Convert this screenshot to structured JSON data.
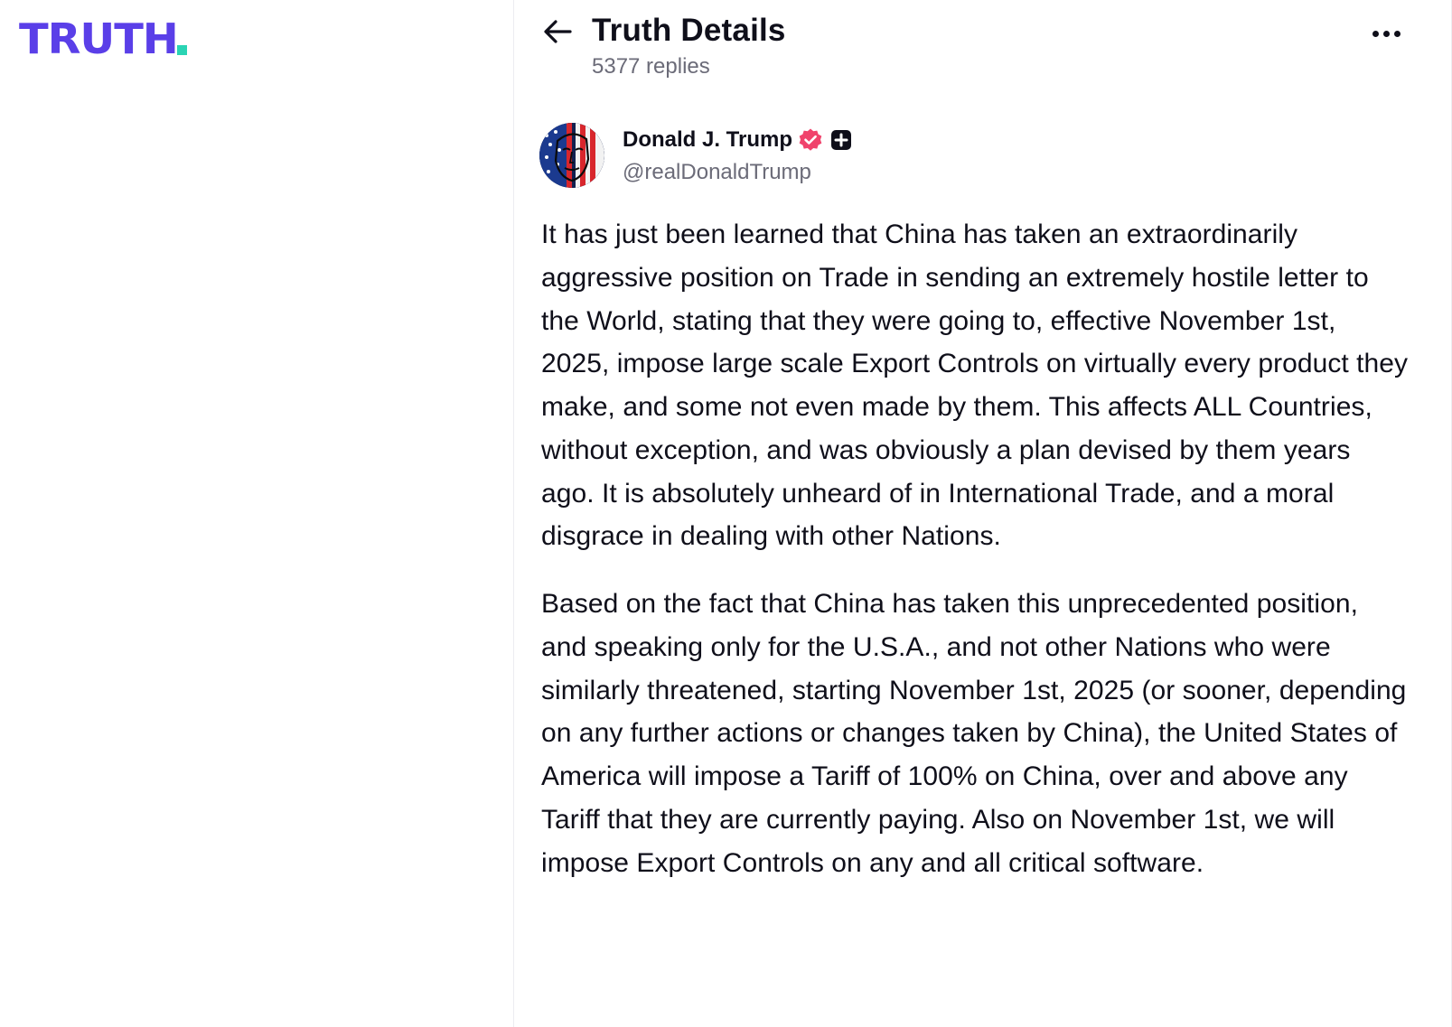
{
  "app": {
    "logo_text": "TRUTH",
    "brand_color": "#5a3fe8",
    "brand_dot_color": "#2ad4b4"
  },
  "header": {
    "back_icon": "arrow-left-icon",
    "title": "Truth Details",
    "reply_count": "5377 replies",
    "more_icon": "more-horizontal-icon"
  },
  "post": {
    "author": {
      "display_name": "Donald J. Trump",
      "handle": "@realDonaldTrump",
      "verified_icon": "verified-badge-icon",
      "verified_color": "#f0436c",
      "plus_icon": "truth-plus-icon"
    },
    "paragraphs": [
      "It has just been learned that China has taken an extraordinarily aggressive position on Trade in sending an extremely hostile letter to the World, stating that they were going to, effective November 1st, 2025, impose large scale Export Controls on virtually every product they make, and some not even made by them. This affects ALL Countries, without exception, and was obviously a plan devised by them years ago. It is absolutely unheard of in International Trade, and a moral disgrace in dealing with other Nations.",
      "Based on the fact that China has taken this unprecedented position, and speaking only for the U.S.A., and not other Nations who were similarly threatened, starting November 1st, 2025 (or sooner, depending on any further actions or changes taken by China), the United States of America will impose a Tariff of 100% on China, over and above any Tariff that they are currently paying. Also on November 1st, we will impose Export Controls on any and all critical software."
    ]
  }
}
